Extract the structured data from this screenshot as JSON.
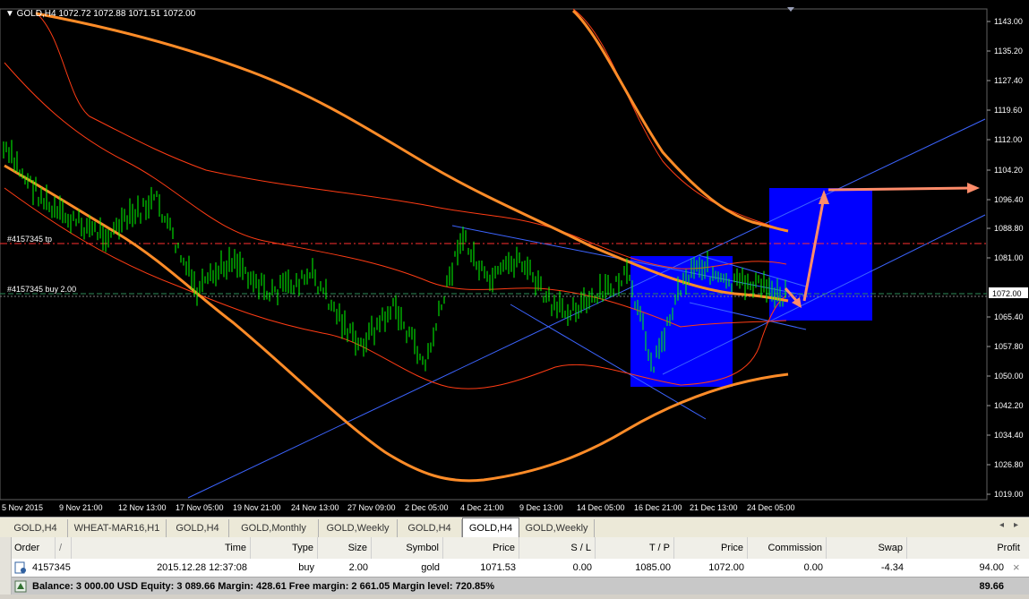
{
  "chart": {
    "symbol_header": "▼ GOLD,H4  1072.72 1072.88 1071.51 1072.00",
    "price_labels": [
      "1143.00",
      "1135.20",
      "1127.40",
      "1119.60",
      "1112.00",
      "1104.20",
      "1096.40",
      "1088.80",
      "1081.00",
      "1072.00",
      "1065.40",
      "1057.80",
      "1050.00",
      "1042.20",
      "1034.40",
      "1026.80",
      "1019.00"
    ],
    "current_price": "1072.00",
    "time_labels": [
      "5 Nov 2015",
      "9 Nov 21:00",
      "12 Nov 13:00",
      "17 Nov 05:00",
      "19 Nov 21:00",
      "24 Nov 13:00",
      "27 Nov 09:00",
      "2 Dec 05:00",
      "4 Dec 21:00",
      "9 Dec 13:00",
      "14 Dec 05:00",
      "16 Dec 21:00",
      "21 Dec 13:00",
      "24 Dec 05:00"
    ],
    "order_tp_label": "#4157345 tp",
    "order_buy_label": "#4157345 buy 2.00",
    "colors": {
      "background": "#000000",
      "candles": "#00ff00",
      "ma_line": "#ff8c28",
      "bands": "#ff3c14",
      "trendlines": "#3c64ff",
      "highlight_box": "#0000ff",
      "tp_line": "#ff3030",
      "buy_line": "#2e8b57"
    }
  },
  "tabs": {
    "items": [
      "GOLD,H4",
      "WHEAT-MAR16,H1",
      "GOLD,H4",
      "GOLD,Monthly",
      "GOLD,Weekly",
      "GOLD,H4",
      "GOLD,H4",
      "GOLD,Weekly"
    ],
    "active_index": 6,
    "left_arrow": "◂",
    "right_arrow": "▸"
  },
  "terminal": {
    "columns": [
      "Order",
      "/",
      "Time",
      "Type",
      "Size",
      "Symbol",
      "Price",
      "S / L",
      "T / P",
      "Price",
      "Commission",
      "Swap",
      "Profit"
    ],
    "row": {
      "order": "4157345",
      "time": "2015.12.28 12:37:08",
      "type": "buy",
      "size": "2.00",
      "symbol": "gold",
      "price": "1071.53",
      "sl": "0.00",
      "tp": "1085.00",
      "current_price": "1072.00",
      "commission": "0.00",
      "swap": "-4.34",
      "profit": "94.00",
      "close_symbol": "×"
    },
    "balance_text": "Balance: 3 000.00 USD  Equity: 3 089.66  Margin: 428.61  Free margin: 2 661.05  Margin level: 720.85%",
    "balance_total": "89.66"
  }
}
